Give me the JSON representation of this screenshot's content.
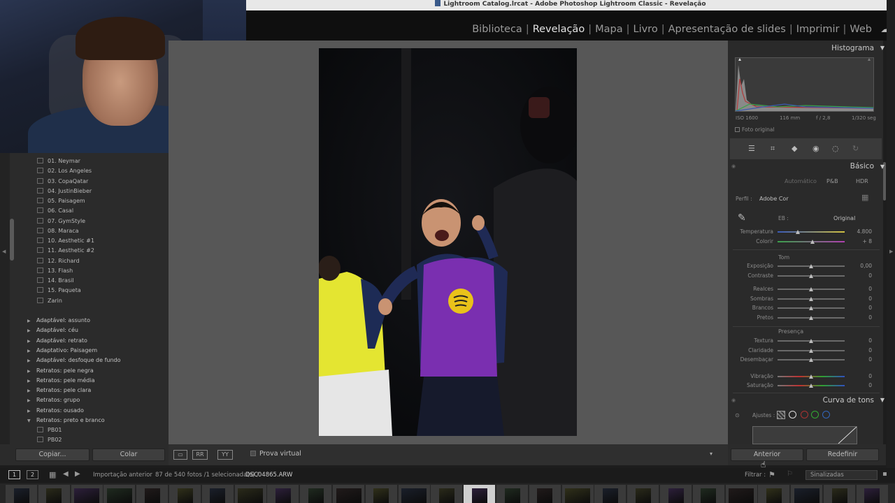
{
  "window": {
    "title": "Lightroom Catalog.lrcat - Adobe Photoshop Lightroom Classic - Revelação"
  },
  "modules": {
    "items": [
      "Biblioteca",
      "Revelação",
      "Mapa",
      "Livro",
      "Apresentação de slides",
      "Imprimir",
      "Web"
    ],
    "active": "Revelação",
    "cloud_icon": "cloud-icon"
  },
  "left_panel": {
    "presets": [
      "01. Neymar",
      "02. Los Angeles",
      "03. CopaQatar",
      "04. JustinBieber",
      "05. Paisagem",
      "06. Casal",
      "07. GymStyle",
      "08. Maraca",
      "10. Aesthetic #1",
      "11. Aesthetic #2",
      "12. Richard",
      "13. Flash",
      "14. Brasil",
      "15. Paqueta",
      "Zarin"
    ],
    "groups": [
      "Adaptável: assunto",
      "Adaptável: céu",
      "Adaptável: retrato",
      "Adaptativo: Paisagem",
      "Adaptável: desfoque de fundo",
      "Retratos: pele negra",
      "Retratos: pele média",
      "Retratos: pele clara",
      "Retratos: grupo",
      "Retratos: ousado",
      "Retratos: preto e branco"
    ],
    "expanded_group": "Retratos: preto e branco",
    "subpresets": [
      "PB01",
      "PB02"
    ],
    "copy_button": "Copiar...",
    "paste_button": "Colar"
  },
  "toolbar": {
    "soft_proof": "Prova virtual"
  },
  "right_panel": {
    "histogram": {
      "title": "Histograma",
      "iso": "ISO 1600",
      "focal": "116 mm",
      "aperture": "f / 2,8",
      "shutter": "1/320 seg",
      "original_photo": "Foto original"
    },
    "basic": {
      "title": "Básico",
      "treatments": [
        "Automático",
        "P&B",
        "HDR"
      ],
      "profile_label": "Perfil :",
      "profile_value": "Adobe Cor",
      "wb_label": "EB :",
      "wb_value": "Original",
      "sliders_wb": [
        {
          "label": "Temperatura",
          "value": "4.800",
          "pos": 0.3
        },
        {
          "label": "Colorir",
          "value": "+ 8",
          "pos": 0.52
        }
      ],
      "tone_title": "Tom",
      "sliders_tone": [
        {
          "label": "Exposição",
          "value": "0,00",
          "pos": 0.5
        },
        {
          "label": "Contraste",
          "value": "0",
          "pos": 0.5
        },
        {
          "label": "Realces",
          "value": "0",
          "pos": 0.5
        },
        {
          "label": "Sombras",
          "value": "0",
          "pos": 0.5
        },
        {
          "label": "Brancos",
          "value": "0",
          "pos": 0.5
        },
        {
          "label": "Pretos",
          "value": "0",
          "pos": 0.5
        }
      ],
      "presence_title": "Presença",
      "sliders_presence": [
        {
          "label": "Textura",
          "value": "0",
          "pos": 0.5
        },
        {
          "label": "Claridade",
          "value": "0",
          "pos": 0.5
        },
        {
          "label": "Desembaçar",
          "value": "0",
          "pos": 0.5
        },
        {
          "label": "Vibração",
          "value": "0",
          "pos": 0.5
        },
        {
          "label": "Saturação",
          "value": "0",
          "pos": 0.5
        }
      ]
    },
    "tone_curve": {
      "title": "Curva de tons",
      "adjust_label": "Ajustes :"
    },
    "prev_button": "Anterior",
    "reset_button": "Redefinir"
  },
  "filmstrip": {
    "screen1": "1",
    "screen2": "2",
    "source": "Importação anterior",
    "count": "87 de 540 fotos /1 selecionada(s) /",
    "filename": "DSC04865.ARW",
    "filter_label": "Filtrar :",
    "filter_value": "Sinalizadas",
    "thumb_count": 27
  },
  "colors": {
    "accent_purple": "#7a2fb0",
    "accent_yellow": "#e9e62a"
  }
}
